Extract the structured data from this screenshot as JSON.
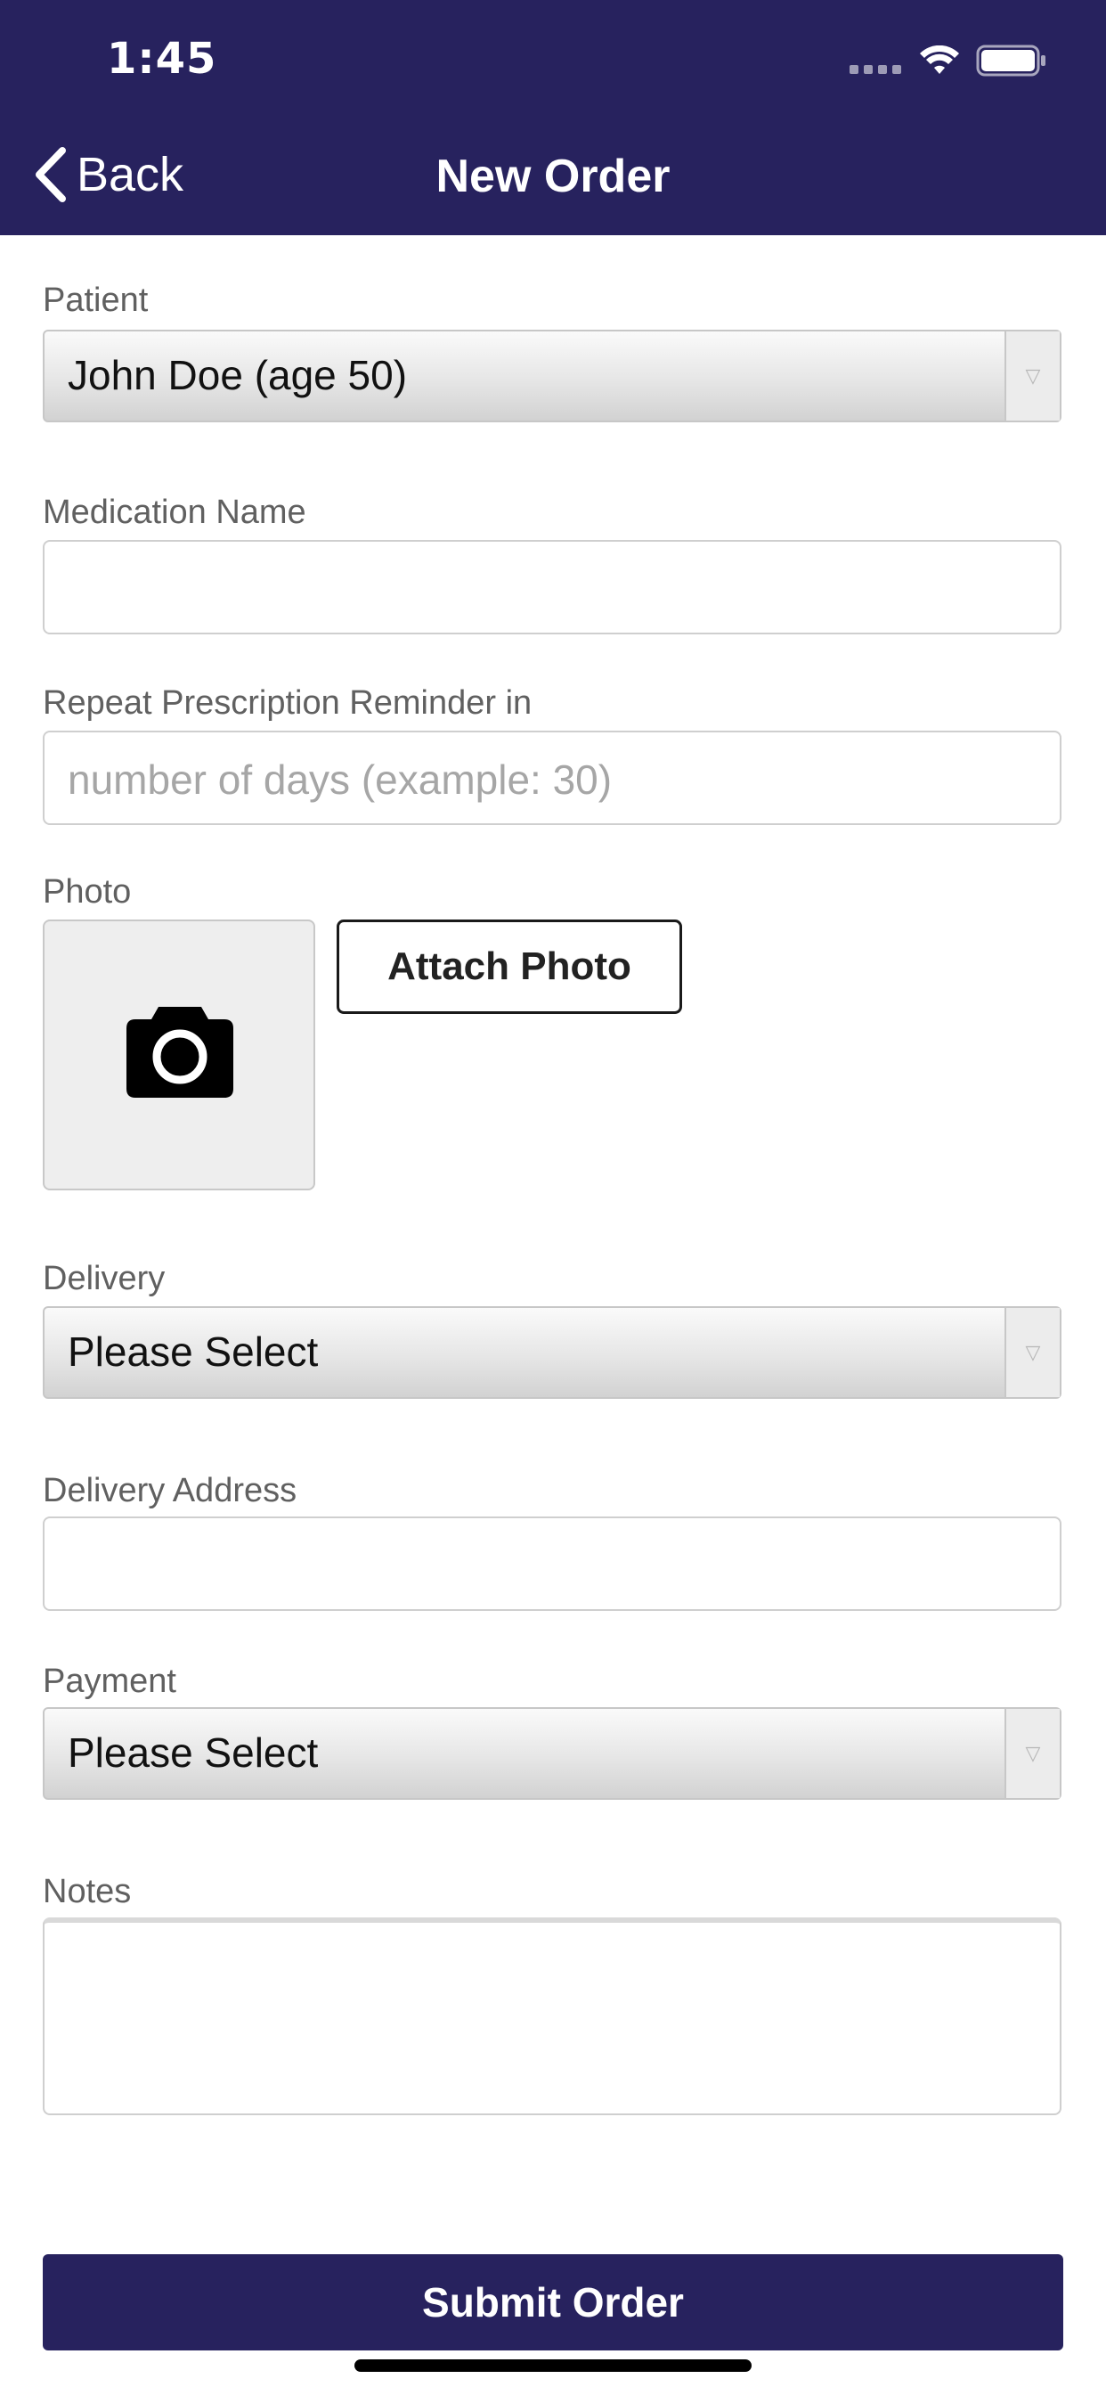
{
  "status_bar": {
    "time": "1:45",
    "icons": [
      "cellular-signal-icon",
      "wifi-icon",
      "battery-icon"
    ]
  },
  "nav": {
    "back_label": "Back",
    "title": "New Order"
  },
  "form": {
    "patient": {
      "label": "Patient",
      "value": "John Doe (age 50)"
    },
    "medication": {
      "label": "Medication Name",
      "value": ""
    },
    "reminder": {
      "label": "Repeat Prescription Reminder in",
      "placeholder": "number of days (example: 30)"
    },
    "photo": {
      "label": "Photo",
      "attach_label": "Attach Photo",
      "icon": "camera-icon"
    },
    "delivery": {
      "label": "Delivery",
      "value": "Please Select"
    },
    "delivery_address": {
      "label": "Delivery Address",
      "value": ""
    },
    "payment": {
      "label": "Payment",
      "value": "Please Select"
    },
    "notes": {
      "label": "Notes",
      "value": ""
    },
    "submit_label": "Submit Order"
  },
  "colors": {
    "brand": "#27225e",
    "label": "#606060",
    "placeholder": "#a6a6a6",
    "border": "#cfcfcf"
  }
}
